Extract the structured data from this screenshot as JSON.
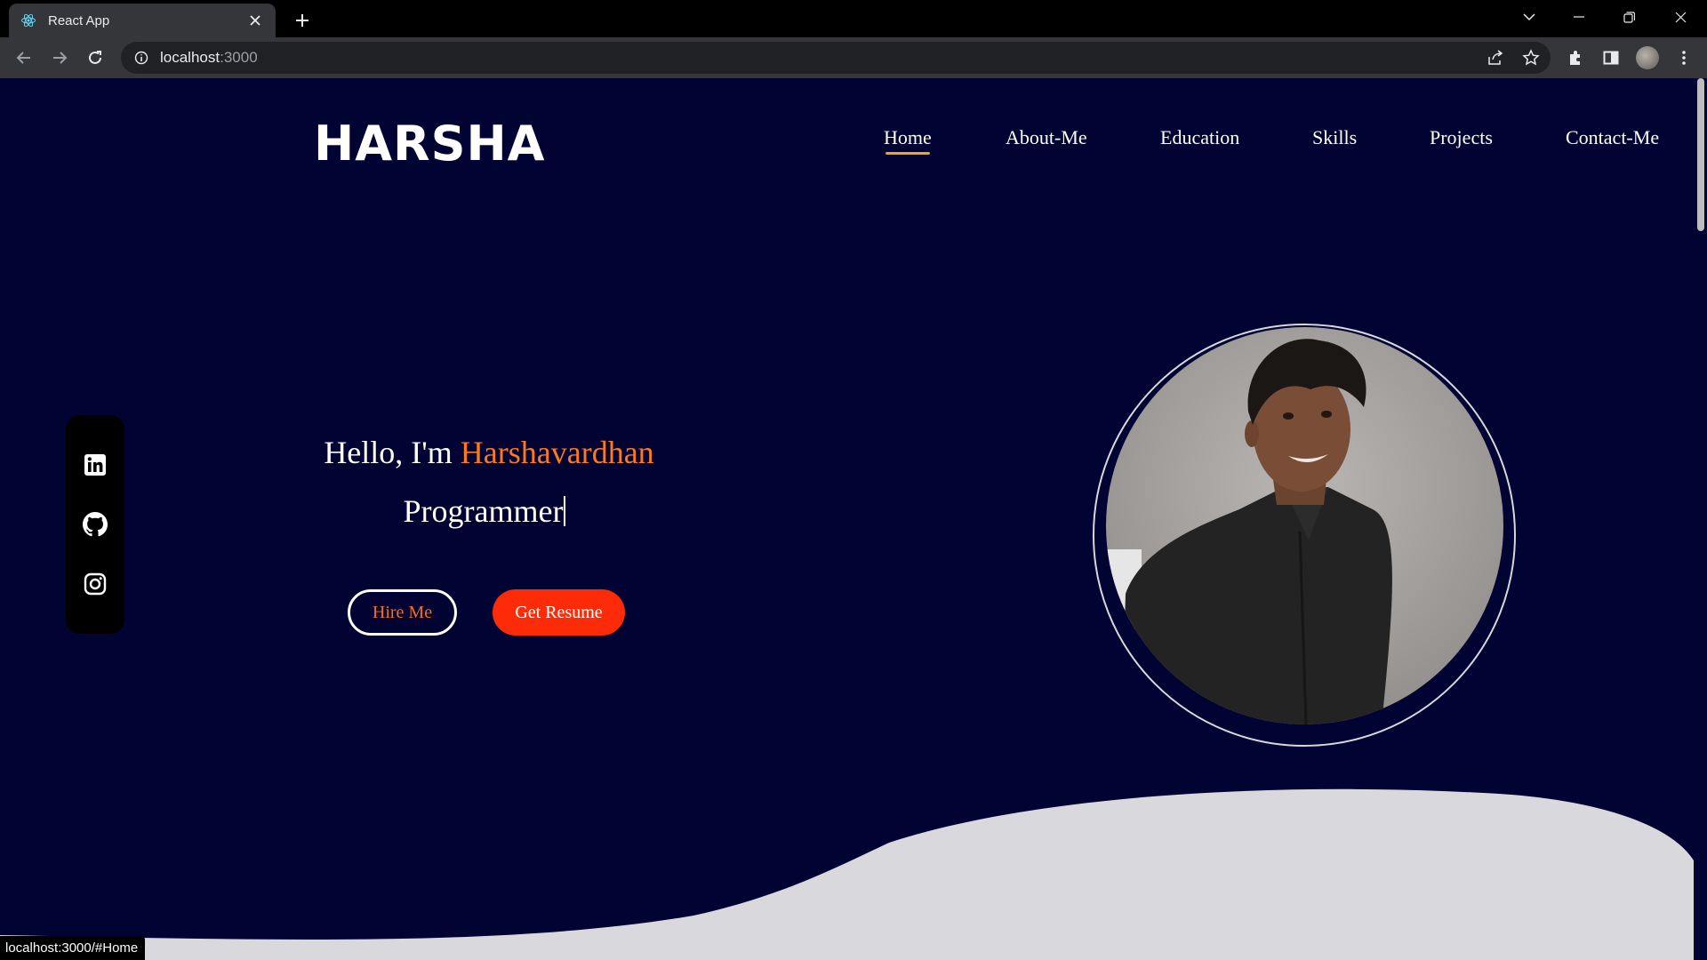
{
  "browser": {
    "tab_title": "React App",
    "url_host": "localhost",
    "url_port": ":3000",
    "status_url": "localhost:3000/#Home"
  },
  "site": {
    "logo": "HARSHA",
    "nav": [
      "Home",
      "About-Me",
      "Education",
      "Skills",
      "Projects",
      "Contact-Me"
    ],
    "active_nav": "Home",
    "greeting_prefix": "Hello, I'm ",
    "greeting_name": "Harshavardhan",
    "typed_role": "Programmer",
    "hire_button": "Hire Me",
    "resume_button": "Get Resume",
    "social_icons": [
      "linkedin-icon",
      "github-icon",
      "instagram-icon"
    ]
  },
  "colors": {
    "background": "#010332",
    "accent_orange": "#fb7921",
    "resume_button": "#fd2b07",
    "nav_underline": "#f6a21c",
    "wave": "#d9d8dc"
  }
}
